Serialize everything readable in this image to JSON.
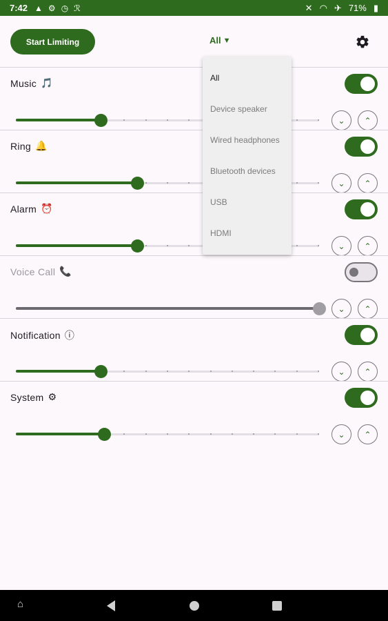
{
  "status_bar": {
    "time": "7:42",
    "battery": "71%",
    "icons": [
      "warning-icon",
      "settings-sync-icon",
      "alarm-clock-icon",
      "app-icon",
      "mute-icon",
      "wifi-icon",
      "airplane-icon",
      "battery-icon"
    ]
  },
  "header": {
    "start_button": "Start Limiting",
    "device_selected": "All",
    "settings_icon": "gear-icon"
  },
  "dropdown": {
    "options": [
      "All",
      "Device speaker",
      "Wired headphones",
      "Bluetooth devices",
      "USB",
      "HDMI"
    ],
    "selected_index": 0
  },
  "streams": [
    {
      "label": "Music",
      "emoji": "🎵",
      "enabled": true,
      "level": 0.28
    },
    {
      "label": "Ring",
      "emoji": "🔔",
      "enabled": true,
      "level": 0.4
    },
    {
      "label": "Alarm",
      "emoji": "⏰",
      "enabled": true,
      "level": 0.4
    },
    {
      "label": "Voice Call",
      "emoji": "📞",
      "enabled": false,
      "level": 1.0
    },
    {
      "label": "Notification",
      "emoji": "ⓘ",
      "enabled": true,
      "level": 0.28
    },
    {
      "label": "System",
      "emoji": "⚙",
      "enabled": true,
      "level": 0.29
    }
  ],
  "colors": {
    "accent": "#2e6b1e",
    "background": "#fdf8fc",
    "navbar": "#000000"
  }
}
